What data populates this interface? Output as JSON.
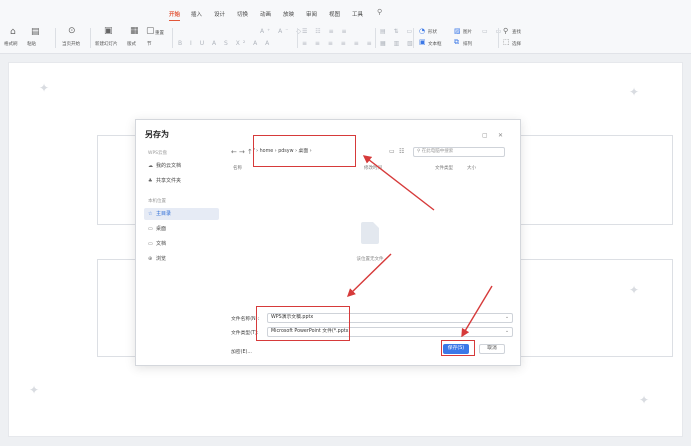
{
  "ribbon": {
    "tabs": [
      "开始",
      "插入",
      "设计",
      "切换",
      "动画",
      "放映",
      "审阅",
      "视图",
      "工具"
    ],
    "tab_active": "开始",
    "left_groups": {
      "format_painter": "格式刷",
      "paste": "粘贴",
      "play": "当页开始",
      "new_slide": "新建幻灯片",
      "layout": "版式",
      "section": "节",
      "reset": "重置"
    },
    "right_groups": {
      "shape": "形状",
      "picture": "图片",
      "textbox": "文本框",
      "arrange": "排列",
      "find": "查找",
      "select": "选择"
    }
  },
  "dialog": {
    "title": "另存为",
    "sidebar": {
      "group1": "WPS云盘",
      "items1": [
        {
          "icon": "cloud-icon",
          "label": "我的云文档"
        },
        {
          "icon": "users-icon",
          "label": "共享文件夹"
        }
      ],
      "group2": "本机位置",
      "items2": [
        {
          "icon": "star-icon",
          "label": "主目录"
        },
        {
          "icon": "folder-icon",
          "label": "桌面"
        },
        {
          "icon": "folder-icon",
          "label": "文档"
        },
        {
          "icon": "globe-icon",
          "label": "浏览"
        }
      ]
    },
    "nav": {
      "back": "←",
      "forward": "→",
      "up": "↑",
      "path": [
        "/",
        "home",
        "pdsyw",
        "桌面"
      ],
      "search_placeholder": "在此电脑中搜索"
    },
    "columns": {
      "name": "名称",
      "modified": "修改时间",
      "type": "文件类型",
      "size": "大小"
    },
    "empty_message": "该位置无文件",
    "form": {
      "filename_label": "文件名称(N):",
      "filename_value": "WPS演示文稿.pptx",
      "filetype_label": "文件类型(T):",
      "filetype_value": "Microsoft PowerPoint 文件(*.pptx)",
      "encrypt": "加密(E)...",
      "save": "保存(S)",
      "cancel": "取消"
    }
  },
  "colors": {
    "accent": "#3b78e7",
    "tab_active": "#e2573a",
    "annotation": "#d63a3a"
  }
}
